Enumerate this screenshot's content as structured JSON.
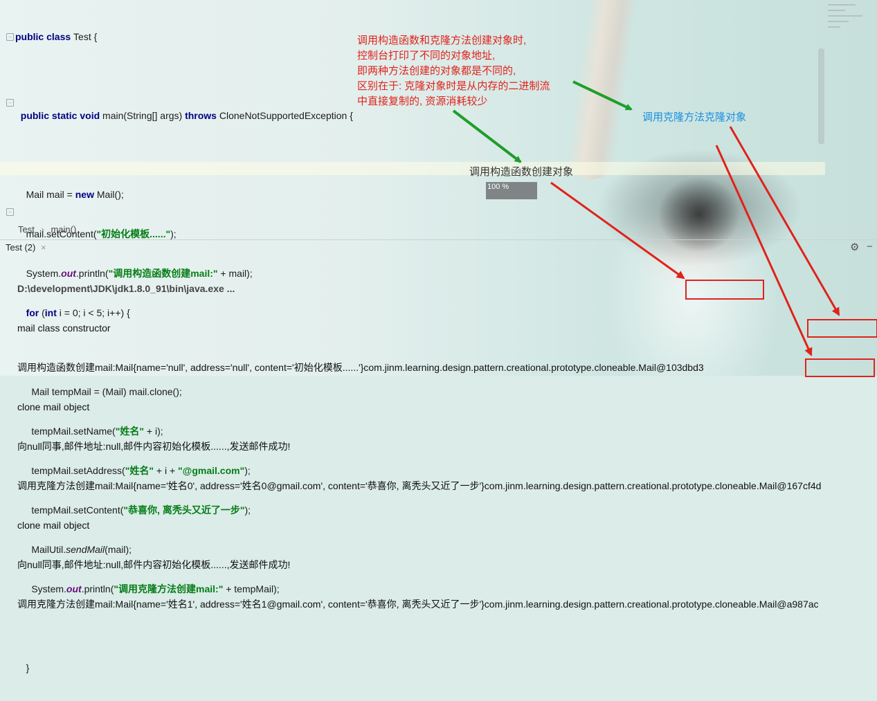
{
  "editor": {
    "lines": {
      "l1": {
        "kw1": "public class ",
        "rest": "Test {"
      },
      "l3": {
        "kw1": "public static void ",
        "mid": "main(String[] args) ",
        "kw2": "throws ",
        "rest": "CloneNotSupportedException {"
      },
      "l5": {
        "a": "Mail mail = ",
        "kw": "new ",
        "b": "Mail();"
      },
      "l6": {
        "a": "mail.setContent(",
        "s": "\"初始化模板......\"",
        "b": ");"
      },
      "l7": {
        "a": "System.",
        "f": "out",
        "b": ".println(",
        "s": "\"调用构造函数创建mail:\"",
        "c": " + mail);"
      },
      "l8": {
        "kw1": "for ",
        "a": "(",
        "kw2": "int ",
        "b": "i = 0; i < 5; i++) {"
      },
      "l10": {
        "a": "Mail tempMail = (Mail) mail.clone();"
      },
      "l11": {
        "a": "tempMail.setName(",
        "s": "\"姓名\"",
        "b": " + i);"
      },
      "l12": {
        "a": "tempMail.setAddress(",
        "s1": "\"姓名\"",
        "b": " + i + ",
        "s2": "\"@gmail.com\"",
        "c": ");"
      },
      "l13": {
        "a": "tempMail.setContent(",
        "s": "\"恭喜你, 离秃头又近了一步\"",
        "b": ");"
      },
      "l14": {
        "a": "MailUtil.",
        "i": "sendMail",
        "b": "(mail);"
      },
      "l15": {
        "a": "System.",
        "f": "out",
        "b": ".println(",
        "s": "\"调用克隆方法创建mail:\"",
        "c": " + tempMail);"
      },
      "l17": {
        "a": "}"
      }
    }
  },
  "breadcrumb": {
    "file": "Test",
    "sep": "›",
    "method": "main()"
  },
  "run_panel": {
    "title": "Test (2)",
    "close": "×"
  },
  "console": [
    "D:\\development\\JDK\\jdk1.8.0_91\\bin\\java.exe ...",
    "mail class constructor",
    "调用构造函数创建mail:Mail{name='null', address='null', content='初始化模板......'}com.jinm.learning.design.pattern.creational.prototype.cloneable.Mail@103dbd3",
    "clone mail object",
    "向null同事,邮件地址:null,邮件内容初始化模板......,发送邮件成功!",
    "调用克隆方法创建mail:Mail{name='姓名0', address='姓名0@gmail.com', content='恭喜你, 离秃头又近了一步'}com.jinm.learning.design.pattern.creational.prototype.cloneable.Mail@167cf4d",
    "clone mail object",
    "向null同事,邮件地址:null,邮件内容初始化模板......,发送邮件成功!",
    "调用克隆方法创建mail:Mail{name='姓名1', address='姓名1@gmail.com', content='恭喜你, 离秃头又近了一步'}com.jinm.learning.design.pattern.creational.prototype.cloneable.Mail@a987ac"
  ],
  "annotations": {
    "red_note": "调用构造函数和克隆方法创建对象时,\n控制台打印了不同的对象地址,\n即两种方法创建的对象都是不同的,\n区别在于: 克隆对象时是从内存的二进制流\n中直接复制的, 资源消耗较少",
    "clone_label": "调用克隆方法克隆对象",
    "constructor_label": "调用构造函数创建对象",
    "progress": "100 %",
    "colors": {
      "red": "#e0221b",
      "green": "#1e9e2a",
      "blue": "#1a8fe0"
    }
  },
  "icons": {
    "gear": "gear-icon",
    "minimize": "minimize-icon",
    "fold": "fold-icon"
  }
}
